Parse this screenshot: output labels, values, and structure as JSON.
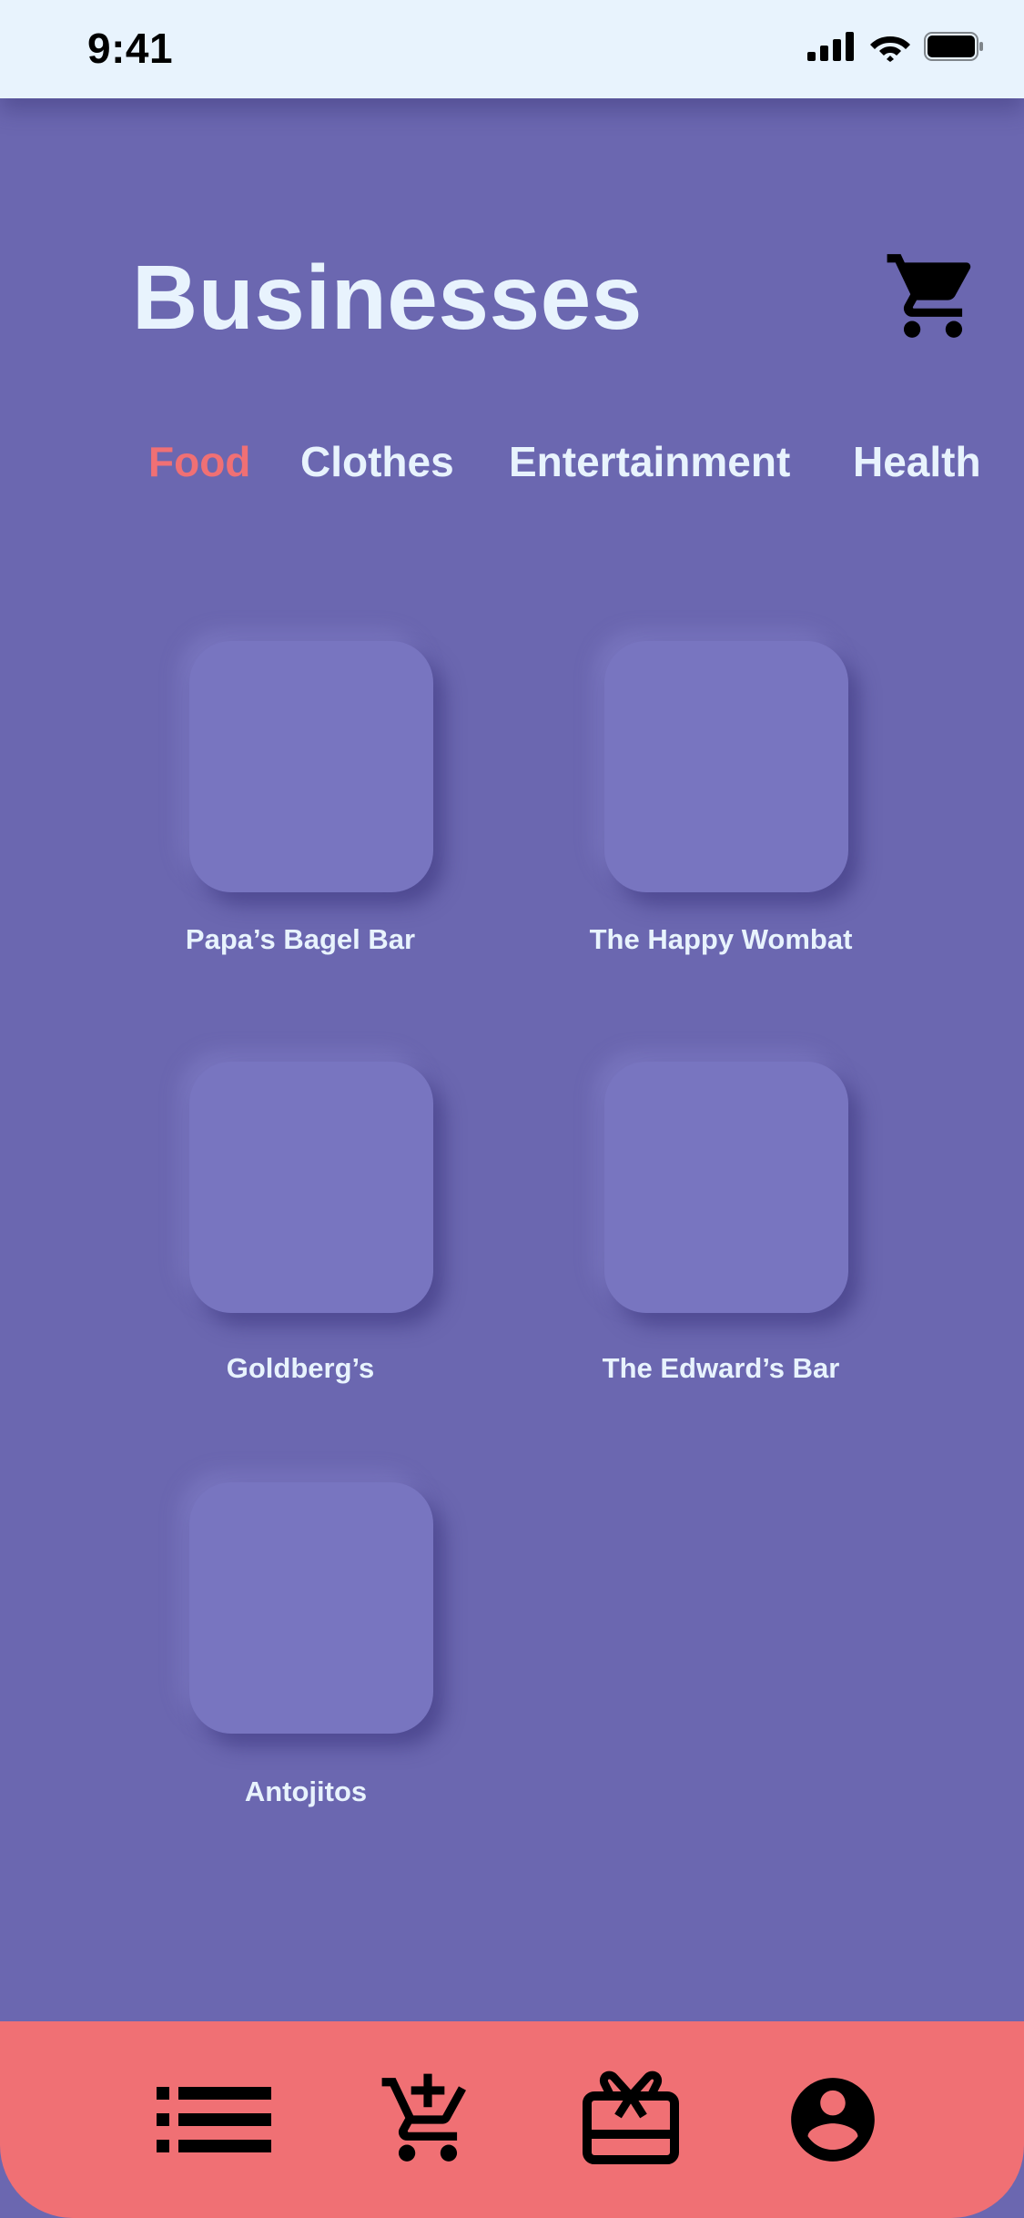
{
  "status_bar": {
    "time": "9:41"
  },
  "header": {
    "title": "Businesses",
    "cart_icon": "cart-icon"
  },
  "tabs": [
    {
      "label": "Food",
      "active": true
    },
    {
      "label": "Clothes",
      "active": false
    },
    {
      "label": "Entertainment",
      "active": false
    },
    {
      "label": "Health",
      "active": false
    }
  ],
  "businesses": [
    {
      "name": "Papa’s Bagel Bar"
    },
    {
      "name": "The Happy Wombat"
    },
    {
      "name": "Goldberg’s"
    },
    {
      "name": "The Edward’s Bar"
    },
    {
      "name": "Antojitos"
    }
  ],
  "bottom_nav": {
    "items": [
      {
        "icon": "list-icon"
      },
      {
        "icon": "add-to-cart-icon"
      },
      {
        "icon": "gift-card-icon"
      },
      {
        "icon": "account-icon"
      }
    ]
  },
  "colors": {
    "background": "#6B67B0",
    "card": "#7875C0",
    "accent": "#F07074",
    "status_bar": "#E8F3FD",
    "text_light": "#E8F3FD"
  }
}
